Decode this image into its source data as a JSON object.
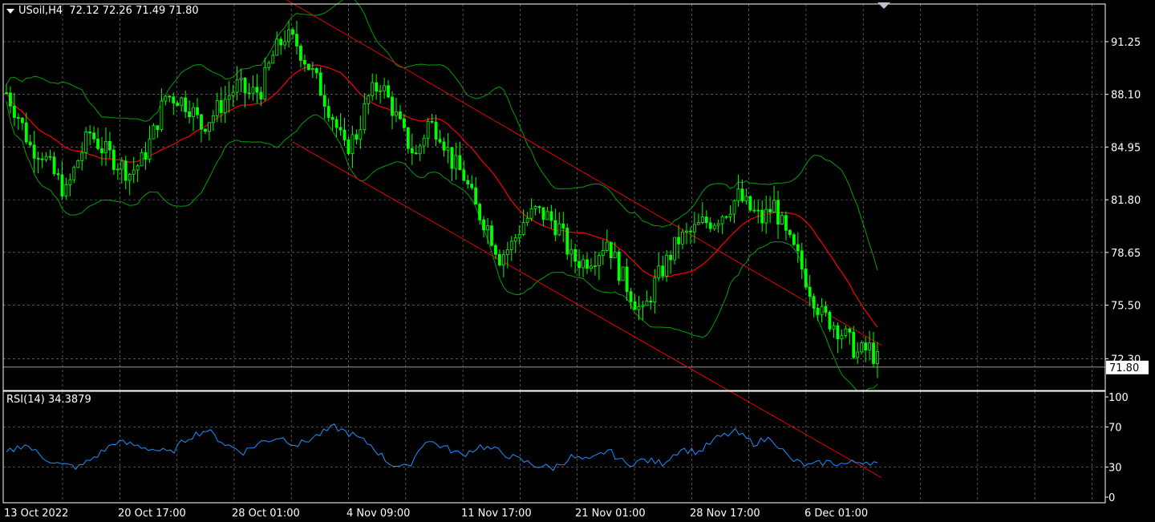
{
  "header": {
    "symbol": "USoil,H4",
    "ohlc": "72.12 72.26 71.49 71.80"
  },
  "rsi_panel": {
    "label": "RSI(14)",
    "value": "34.3879"
  },
  "colors": {
    "background": "#000000",
    "candle": "#00ff00",
    "grid": "#c0c0c0",
    "ma": "#ff0000",
    "bands": "#00a000",
    "channel": "#ff0000",
    "rsi_line": "#1e90ff",
    "axis_text": "#ffffff"
  },
  "chart_data": [
    {
      "type": "candlestick",
      "title": "USoil,H4",
      "indicators": [
        "Bollinger Bands (green)",
        "Moving Average (red)",
        "Regression channel (red)"
      ],
      "y_ticks": [
        "91.25",
        "88.10",
        "84.95",
        "81.80",
        "78.65",
        "75.50",
        "72.30"
      ],
      "ylim": [
        70.4,
        93.5
      ],
      "current_price": "71.80",
      "x_ticks": [
        "13 Oct 2022",
        "20 Oct 17:00",
        "28 Oct 01:00",
        "4 Nov 09:00",
        "11 Nov 17:00",
        "21 Nov 01:00",
        "28 Nov 17:00",
        "6 Dec 01:00"
      ],
      "price_path": [
        [
          0,
          88.2
        ],
        [
          3,
          86.8
        ],
        [
          6,
          85.0
        ],
        [
          9,
          84.6
        ],
        [
          12,
          83.3
        ],
        [
          15,
          82.2
        ],
        [
          18,
          84.2
        ],
        [
          21,
          85.8
        ],
        [
          24,
          84.9
        ],
        [
          28,
          84.0
        ],
        [
          31,
          83.4
        ],
        [
          34,
          84.1
        ],
        [
          37,
          85.8
        ],
        [
          40,
          88.0
        ],
        [
          43,
          87.9
        ],
        [
          46,
          87.4
        ],
        [
          49,
          86.2
        ],
        [
          52,
          86.9
        ],
        [
          55,
          87.8
        ],
        [
          58,
          88.6
        ],
        [
          61,
          88.1
        ],
        [
          64,
          88.4
        ],
        [
          67,
          90.4
        ],
        [
          70,
          91.6
        ],
        [
          73,
          91.1
        ],
        [
          76,
          89.8
        ],
        [
          79,
          88.4
        ],
        [
          82,
          86.8
        ],
        [
          85,
          84.8
        ],
        [
          88,
          85.7
        ],
        [
          91,
          87.9
        ],
        [
          94,
          88.8
        ],
        [
          97,
          87.3
        ],
        [
          100,
          85.6
        ],
        [
          103,
          84.4
        ],
        [
          106,
          86.4
        ],
        [
          109,
          85.9
        ],
        [
          112,
          84.1
        ],
        [
          115,
          83.2
        ],
        [
          118,
          81.3
        ],
        [
          121,
          80.2
        ],
        [
          124,
          78.4
        ],
        [
          127,
          79.1
        ],
        [
          130,
          80.5
        ],
        [
          133,
          81.1
        ],
        [
          136,
          80.8
        ],
        [
          139,
          80.1
        ],
        [
          142,
          78.3
        ],
        [
          145,
          78.1
        ],
        [
          148,
          78.5
        ],
        [
          151,
          79.4
        ],
        [
          154,
          77.6
        ],
        [
          157,
          76.2
        ],
        [
          160,
          74.9
        ],
        [
          163,
          76.8
        ],
        [
          166,
          78.1
        ],
        [
          169,
          79.4
        ],
        [
          172,
          79.8
        ],
        [
          175,
          80.4
        ],
        [
          178,
          80.6
        ],
        [
          181,
          81.2
        ],
        [
          184,
          82.0
        ],
        [
          187,
          81.2
        ],
        [
          190,
          80.6
        ],
        [
          193,
          81.5
        ],
        [
          196,
          79.6
        ],
        [
          199,
          78.3
        ],
        [
          202,
          76.5
        ],
        [
          205,
          74.9
        ],
        [
          208,
          74.4
        ],
        [
          211,
          73.6
        ],
        [
          214,
          72.6
        ],
        [
          217,
          72.9
        ],
        [
          220,
          71.8
        ]
      ],
      "n_bars": 220
    },
    {
      "type": "line",
      "title": "RSI(14) 34.3879",
      "y_ticks": [
        "100",
        "70",
        "30",
        "0"
      ],
      "ylim": [
        0,
        100
      ],
      "series": [
        {
          "name": "RSI(14)",
          "path": [
            [
              0,
              44
            ],
            [
              5,
              53
            ],
            [
              10,
              40
            ],
            [
              15,
              32
            ],
            [
              20,
              30
            ],
            [
              25,
              42
            ],
            [
              30,
              55
            ],
            [
              35,
              52
            ],
            [
              40,
              48
            ],
            [
              45,
              44
            ],
            [
              50,
              60
            ],
            [
              55,
              67
            ],
            [
              60,
              53
            ],
            [
              65,
              45
            ],
            [
              70,
              55
            ],
            [
              75,
              60
            ],
            [
              80,
              52
            ],
            [
              85,
              61
            ],
            [
              90,
              70
            ],
            [
              95,
              62
            ],
            [
              100,
              52
            ],
            [
              105,
              34
            ],
            [
              110,
              29
            ],
            [
              115,
              57
            ],
            [
              120,
              50
            ],
            [
              125,
              42
            ],
            [
              130,
              51
            ],
            [
              135,
              46
            ],
            [
              140,
              38
            ],
            [
              145,
              32
            ],
            [
              150,
              29
            ],
            [
              155,
              40
            ],
            [
              160,
              36
            ],
            [
              165,
              47
            ],
            [
              170,
              33
            ],
            [
              175,
              37
            ],
            [
              180,
              34
            ],
            [
              185,
              48
            ],
            [
              190,
              45
            ],
            [
              195,
              59
            ],
            [
              200,
              65
            ],
            [
              205,
              54
            ],
            [
              210,
              59
            ],
            [
              215,
              38
            ],
            [
              220,
              31
            ],
            [
              225,
              35
            ],
            [
              230,
              33
            ],
            [
              235,
              36
            ],
            [
              240,
              34
            ]
          ]
        }
      ],
      "n_points": 240,
      "last_value": 34.3879
    }
  ]
}
